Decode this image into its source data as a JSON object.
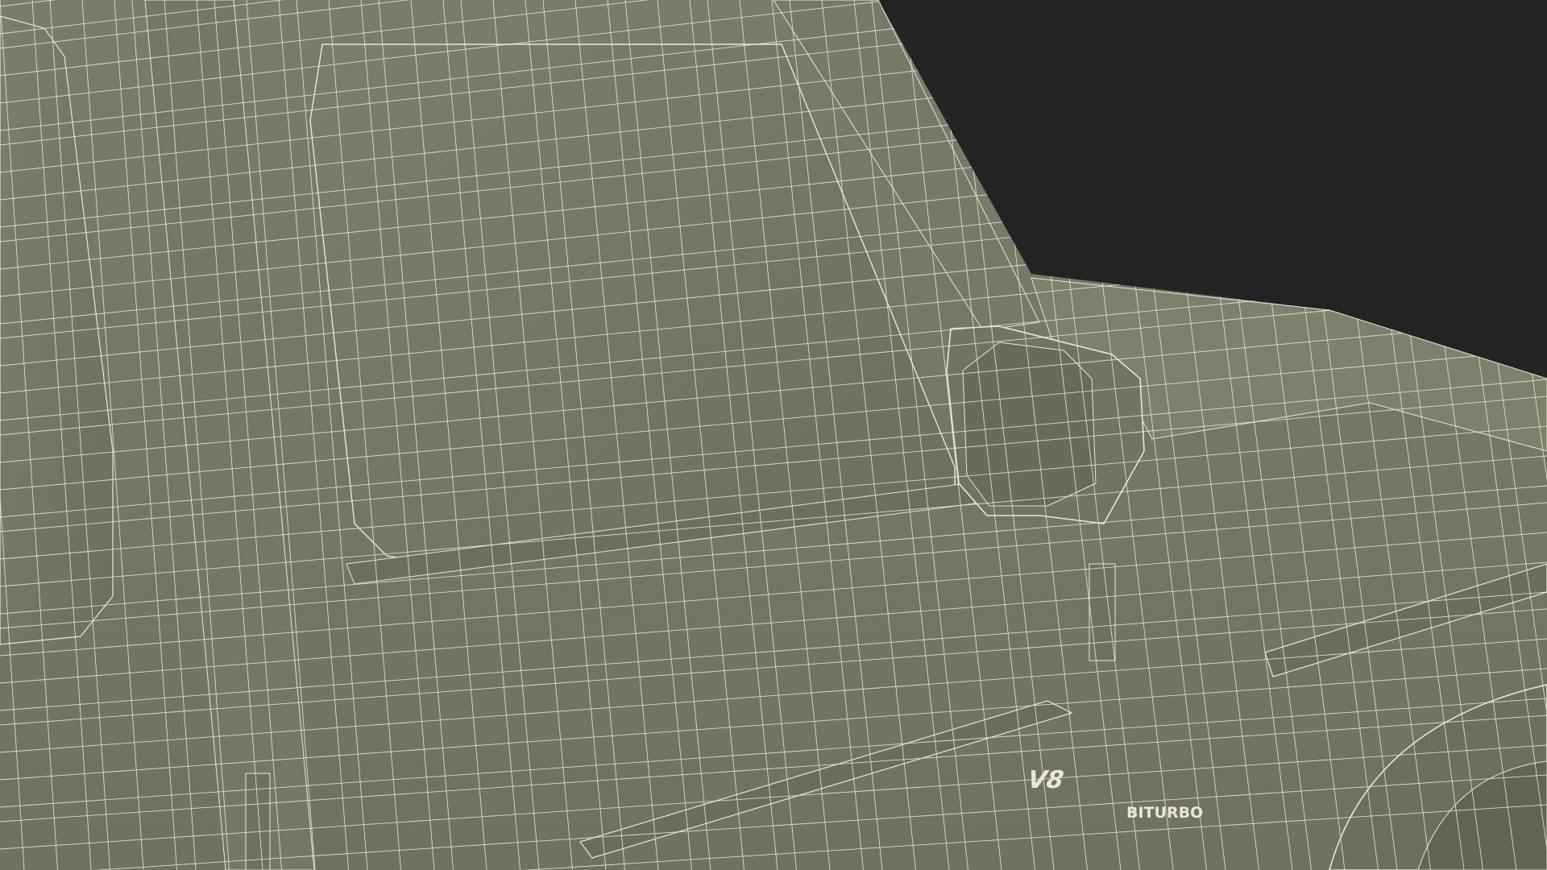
{
  "scene": {
    "background_color": "#232323",
    "body_color": "#777a68",
    "wire_color": "#ece6cf",
    "badge": {
      "line1": "V8",
      "line2": "BITURBO"
    }
  }
}
